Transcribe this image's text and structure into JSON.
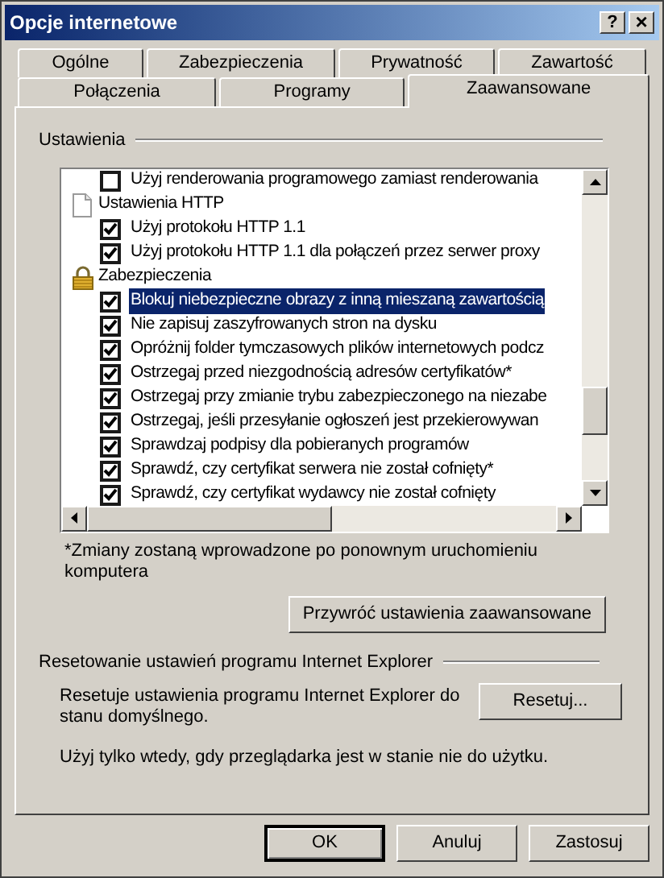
{
  "window": {
    "title": "Opcje internetowe",
    "help": "?",
    "close": "×"
  },
  "tab_rows": [
    [
      {
        "label": "Ogólne",
        "selected": false
      },
      {
        "label": "Zabezpieczenia",
        "selected": false
      },
      {
        "label": "Prywatność",
        "selected": false
      },
      {
        "label": "Zawartość",
        "selected": false
      }
    ],
    [
      {
        "label": "Połączenia",
        "selected": false
      },
      {
        "label": "Programy",
        "selected": false
      },
      {
        "label": "Zaawansowane",
        "selected": true
      }
    ]
  ],
  "settings": {
    "title": "Ustawienia",
    "items": [
      {
        "kind": "checkbox",
        "label": "Użyj renderowania programowego zamiast renderowania",
        "checked": false,
        "selected": false
      },
      {
        "kind": "page-group",
        "label": "Ustawienia HTTP"
      },
      {
        "kind": "checkbox",
        "label": "Użyj protokołu HTTP 1.1",
        "checked": true,
        "selected": false
      },
      {
        "kind": "checkbox",
        "label": "Użyj protokołu HTTP 1.1 dla połączeń przez serwer proxy",
        "checked": true,
        "selected": false
      },
      {
        "kind": "lock-group",
        "label": "Zabezpieczenia"
      },
      {
        "kind": "checkbox",
        "label": "Blokuj niebezpieczne obrazy z inną mieszaną zawartością",
        "checked": true,
        "selected": true
      },
      {
        "kind": "checkbox",
        "label": "Nie zapisuj zaszyfrowanych stron na dysku",
        "checked": true,
        "selected": false
      },
      {
        "kind": "checkbox",
        "label": "Opróżnij folder tymczasowych plików internetowych podcz",
        "checked": true,
        "selected": false
      },
      {
        "kind": "checkbox",
        "label": "Ostrzegaj przed niezgodnością adresów certyfikatów*",
        "checked": true,
        "selected": false
      },
      {
        "kind": "checkbox",
        "label": "Ostrzegaj przy zmianie trybu zabezpieczonego na niezabe",
        "checked": true,
        "selected": false
      },
      {
        "kind": "checkbox",
        "label": "Ostrzegaj, jeśli przesyłanie ogłoszeń jest przekierowywan",
        "checked": true,
        "selected": false
      },
      {
        "kind": "checkbox",
        "label": "Sprawdzaj podpisy dla pobieranych programów",
        "checked": true,
        "selected": false
      },
      {
        "kind": "checkbox",
        "label": "Sprawdź, czy certyfikat serwera nie został cofnięty*",
        "checked": true,
        "selected": false
      },
      {
        "kind": "checkbox",
        "label": "Sprawdź, czy certyfikat wydawcy nie został cofnięty",
        "checked": true,
        "selected": false
      }
    ],
    "note": "*Zmiany zostaną wprowadzone po ponownym uruchomieniu komputera",
    "restore_button": "Przywróć ustawienia zaawansowane"
  },
  "reset": {
    "title": "Resetowanie ustawień programu Internet Explorer",
    "description": "Resetuje ustawienia programu Internet Explorer do stanu domyślnego.",
    "button": "Resetuj...",
    "warning": "Użyj tylko wtedy, gdy przeglądarka jest w stanie nie do użytku."
  },
  "buttons": [
    {
      "label": "OK",
      "default": true
    },
    {
      "label": "Anuluj",
      "default": false
    },
    {
      "label": "Zastosuj",
      "default": false
    }
  ]
}
